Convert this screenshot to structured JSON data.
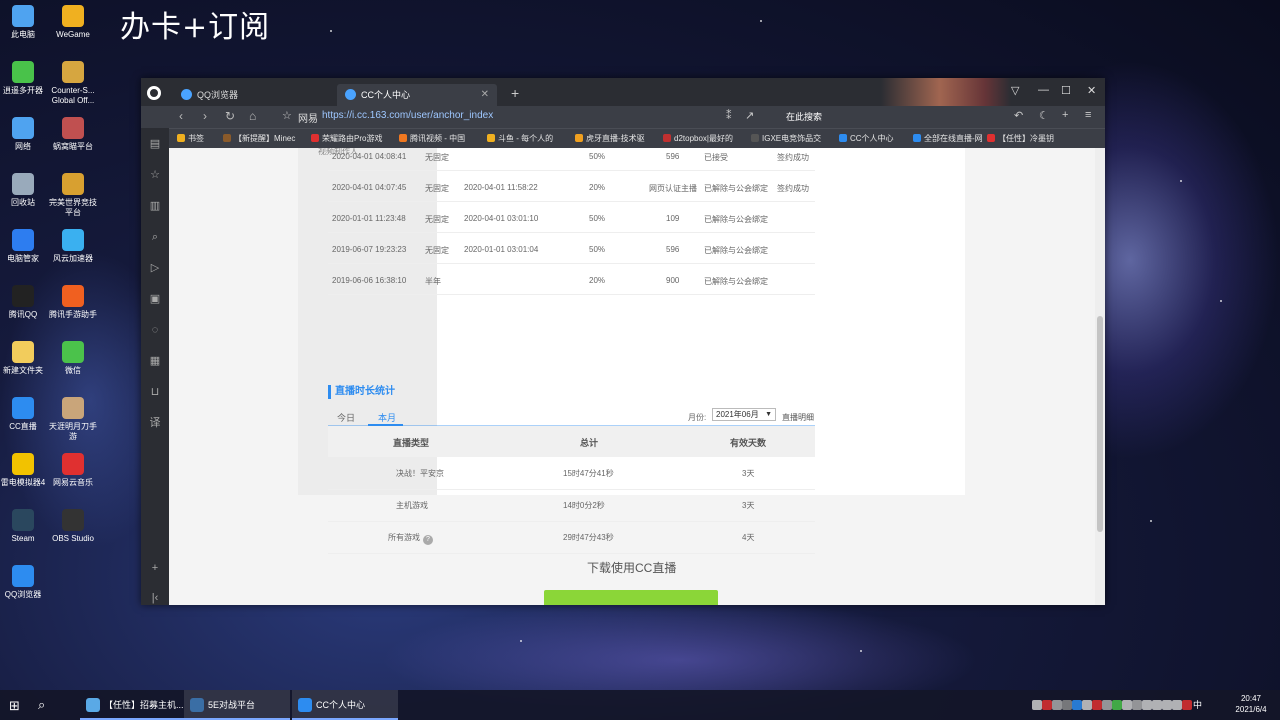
{
  "overlay_text": "办卡+订阅",
  "desktop_icons": [
    {
      "label": "此电脑",
      "icon": "computer-icon",
      "color": "#4fa3f0"
    },
    {
      "label": "WeGame",
      "icon": "wegame-icon",
      "color": "#f0b020"
    },
    {
      "label": "逍遥多开器",
      "icon": "emulator-icon",
      "color": "#49c24a"
    },
    {
      "label": "Counter-S... Global Off...",
      "icon": "csgo-icon",
      "color": "#d6a640"
    },
    {
      "label": "网络",
      "icon": "network-icon",
      "color": "#4fa3f0"
    },
    {
      "label": "蜗窝瞄平台",
      "icon": "platform-icon",
      "color": "#c05050"
    },
    {
      "label": "回收站",
      "icon": "recycle-bin-icon",
      "color": "#9ab"
    },
    {
      "label": "完美世界竞技平台",
      "icon": "perfect-world-icon",
      "color": "#d8a030"
    },
    {
      "label": "电脑管家",
      "icon": "pc-manager-icon",
      "color": "#2d7df0"
    },
    {
      "label": "风云加速器",
      "icon": "accelerator-icon",
      "color": "#3ab0f0"
    },
    {
      "label": "腾讯QQ",
      "icon": "qq-icon",
      "color": "#222"
    },
    {
      "label": "腾讯手游助手",
      "icon": "mobile-game-icon",
      "color": "#f06020"
    },
    {
      "label": "新建文件夹",
      "icon": "folder-icon",
      "color": "#f2cc5c"
    },
    {
      "label": "微信",
      "icon": "wechat-icon",
      "color": "#4bc24b"
    },
    {
      "label": "CC直播",
      "icon": "cc-live-icon",
      "color": "#2d8cf0"
    },
    {
      "label": "天涯明月刀手游",
      "icon": "game-avatar-icon",
      "color": "#c9a57a"
    },
    {
      "label": "雷电模拟器4",
      "icon": "ldplayer-icon",
      "color": "#f2c200"
    },
    {
      "label": "网易云音乐",
      "icon": "netease-music-icon",
      "color": "#e03030"
    },
    {
      "label": "Steam",
      "icon": "steam-icon",
      "color": "#2a475e"
    },
    {
      "label": "OBS Studio",
      "icon": "obs-icon",
      "color": "#333"
    },
    {
      "label": "QQ浏览器",
      "icon": "qq-browser-icon",
      "color": "#2d8cf0"
    }
  ],
  "browser": {
    "tabs": [
      {
        "label": "QQ浏览器",
        "active": false
      },
      {
        "label": "CC个人中心",
        "active": true
      }
    ],
    "address_label": "网易",
    "url": "https://i.cc.163.com/user/anchor_index",
    "search_placeholder": "在此搜索",
    "bookmarks": [
      {
        "label": "书签",
        "color": "#f0b020"
      },
      {
        "label": "【新提醒】Minec",
        "color": "#8a5a2a"
      },
      {
        "label": "荣耀路由Pro游戏",
        "color": "#e03030"
      },
      {
        "label": "腾讯视频 - 中国",
        "color": "#f07820"
      },
      {
        "label": "斗鱼 - 每个人的",
        "color": "#f0b020"
      },
      {
        "label": "虎牙直播-技术驱",
        "color": "#f0a020"
      },
      {
        "label": "d2topbox|最好的",
        "color": "#c03030"
      },
      {
        "label": "IGXE电竞饰品交",
        "color": "#555"
      },
      {
        "label": "CC个人中心",
        "color": "#2d8cf0"
      },
      {
        "label": "全部在线直播-网",
        "color": "#2d8cf0"
      },
      {
        "label": "【任性】冷墨钥",
        "color": "#e03030"
      }
    ]
  },
  "page": {
    "left_pane_text": "视频制作人",
    "history_rows": [
      {
        "start": "2020-04-01 04:08:41",
        "type": "无固定",
        "end": "",
        "share": "50%",
        "fee": "596",
        "status": "已接受",
        "result": "签约成功"
      },
      {
        "start": "2020-04-01 04:07:45",
        "type": "无固定",
        "end": "2020-04-01 11:58:22",
        "share": "20%",
        "fee": "网页认证主播",
        "status": "已解除与公会绑定",
        "result": "签约成功"
      },
      {
        "start": "2020-01-01 11:23:48",
        "type": "无固定",
        "end": "2020-04-01 03:01:10",
        "share": "50%",
        "fee": "109",
        "status": "已解除与公会绑定",
        "result": ""
      },
      {
        "start": "2019-06-07 19:23:23",
        "type": "无固定",
        "end": "2020-01-01 03:01:04",
        "share": "50%",
        "fee": "596",
        "status": "已解除与公会绑定",
        "result": ""
      },
      {
        "start": "2019-06-06 16:38:10",
        "type": "半年",
        "end": "",
        "share": "20%",
        "fee": "900",
        "status": "已解除与公会绑定",
        "result": ""
      }
    ],
    "section_title": "直播时长统计",
    "subtabs": [
      "今日",
      "本月"
    ],
    "month_label": "月份:",
    "month_value": "2021年06月",
    "detail_link": "直播明细",
    "table_headers": [
      "直播类型",
      "总计",
      "有效天数"
    ],
    "table_rows": [
      {
        "type": "决战！平安京",
        "total": "15时47分41秒",
        "days": "3天",
        "help": false
      },
      {
        "type": "主机游戏",
        "total": "14时0分2秒",
        "days": "3天",
        "help": false
      },
      {
        "type": "所有游戏",
        "total": "29时47分43秒",
        "days": "4天",
        "help": true
      }
    ],
    "download_text": "下载使用CC直播"
  },
  "taskbar": {
    "items": [
      {
        "label": "【任性】招募主机...",
        "color": "#5aa9e6",
        "state": "open"
      },
      {
        "label": "5E对战平台",
        "color": "#3a6ea5",
        "state": "active"
      },
      {
        "label": "CC个人中心",
        "color": "#2d8cf0",
        "state": "active"
      }
    ],
    "ime": "中",
    "time": "20:47",
    "date": "2021/6/4"
  }
}
